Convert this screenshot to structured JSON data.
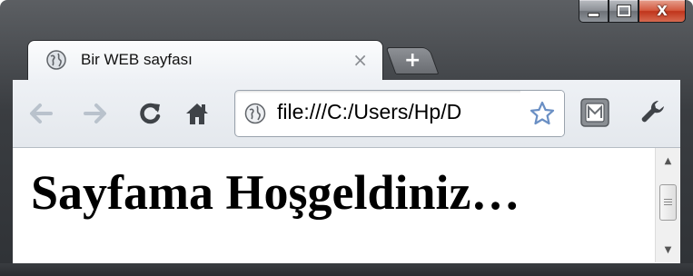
{
  "window": {
    "caption": {
      "minimize_glyph": "minimize-icon",
      "maximize_glyph": "maximize-icon",
      "close_label": "X"
    }
  },
  "tab": {
    "title": "Bir WEB sayfası",
    "close_label": "×",
    "favicon": "globe-icon"
  },
  "new_tab": {
    "label": "+"
  },
  "toolbar": {
    "back_icon": "back-arrow-icon",
    "forward_icon": "forward-arrow-icon",
    "reload_icon": "reload-icon",
    "home_icon": "home-icon",
    "url": "file:///C:/Users/Hp/D",
    "bookmark_icon": "star-icon",
    "extension_icon": "extension-m-icon",
    "menu_icon": "wrench-icon"
  },
  "page": {
    "heading": "Sayfama Hoşgeldiniz…"
  },
  "colors": {
    "frame": "#3a3d41",
    "toolbar": "#e9edf1",
    "close_button": "#c9462c",
    "nav_disabled": "#b9c2cc"
  }
}
